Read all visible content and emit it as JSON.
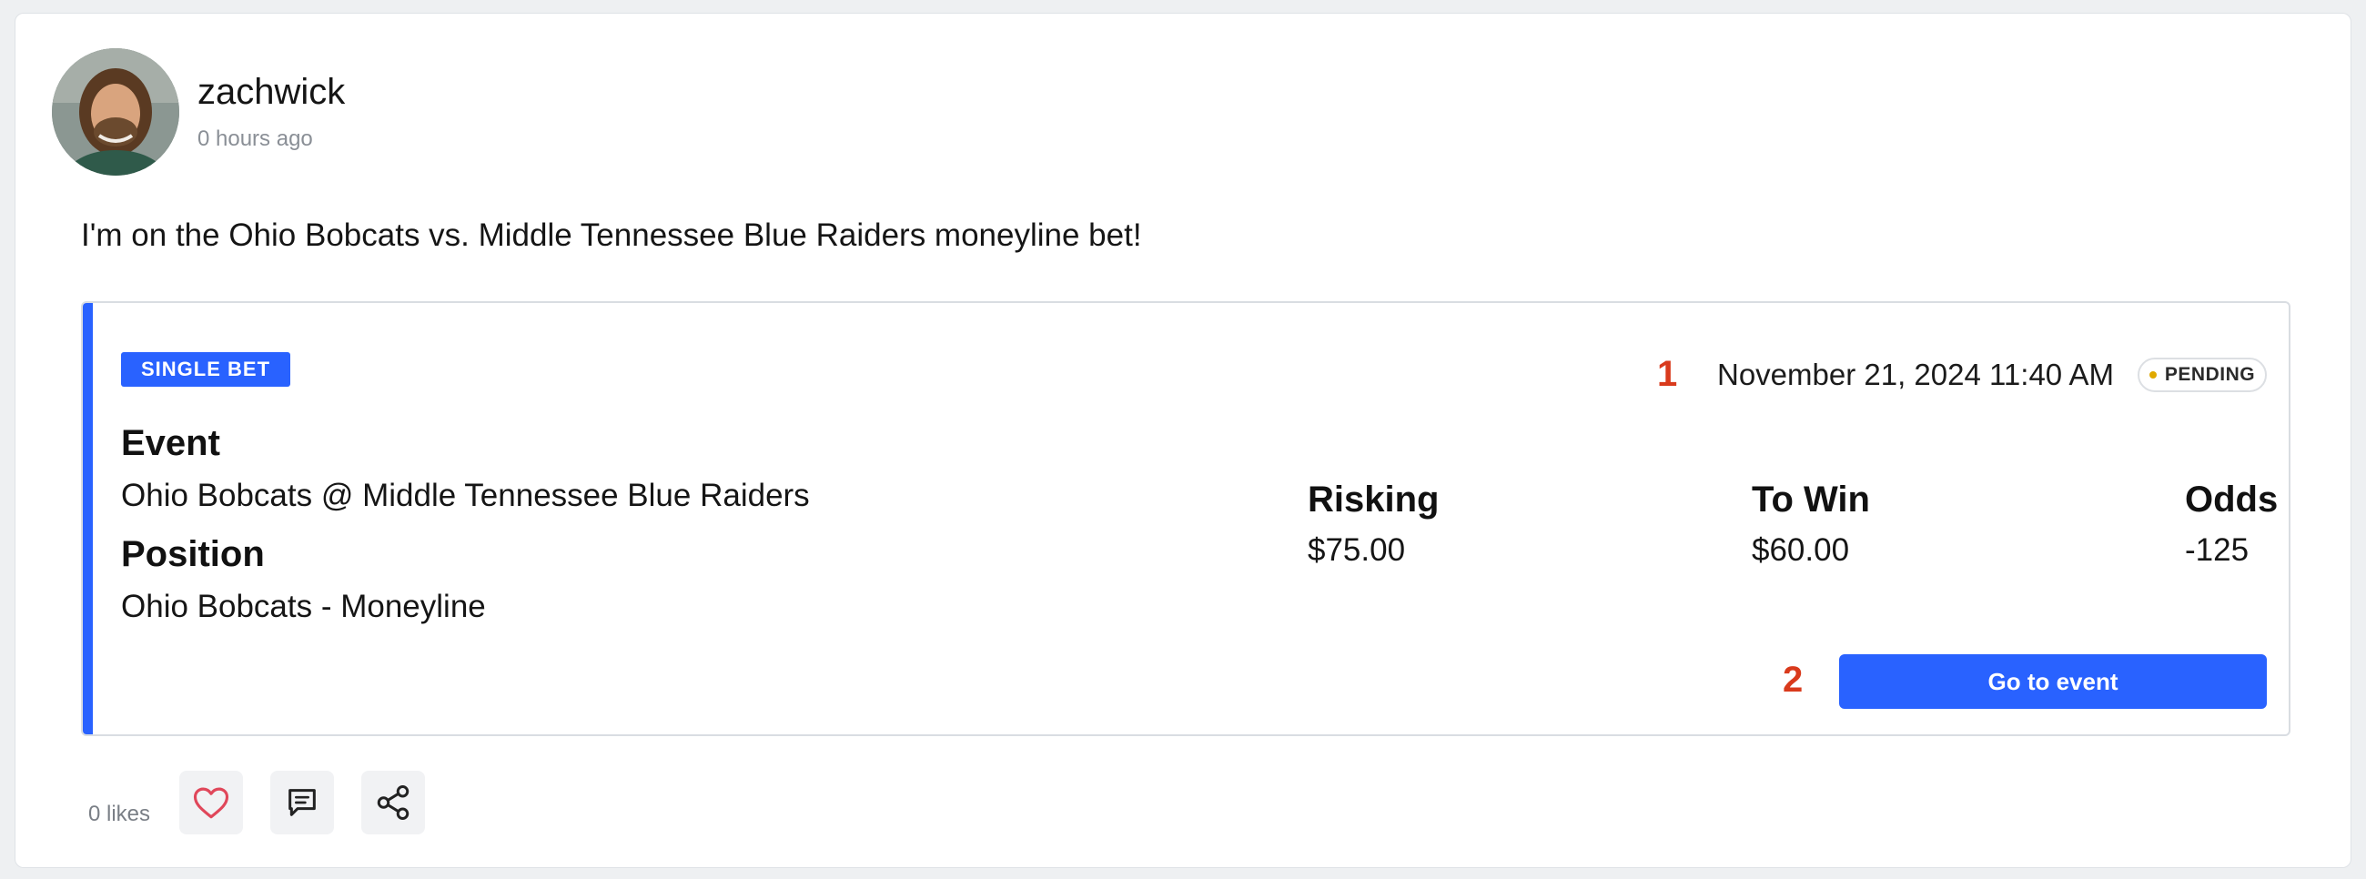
{
  "post": {
    "username": "zachwick",
    "time_ago": "0 hours ago",
    "text": "I'm on the Ohio Bobcats vs. Middle Tennessee Blue Raiders moneyline bet!"
  },
  "bet": {
    "badge": "SINGLE BET",
    "marker_1": "1",
    "marker_2": "2",
    "datetime": "November 21, 2024 11:40 AM",
    "status": "PENDING",
    "event_label": "Event",
    "event_value": "Ohio Bobcats @ Middle Tennessee Blue Raiders",
    "position_label": "Position",
    "position_value": "Ohio Bobcats - Moneyline",
    "risking_label": "Risking",
    "risking_value": "$75.00",
    "towin_label": "To Win",
    "towin_value": "$60.00",
    "odds_label": "Odds",
    "odds_value": "-125",
    "go_button": "Go to event"
  },
  "footer": {
    "likes": "0 likes"
  },
  "colors": {
    "accent": "#2962ff",
    "marker": "#d93a1c",
    "status_dot": "#e0a900",
    "heart": "#e0475a"
  },
  "icons": {
    "like": "heart-icon",
    "comment": "comment-icon",
    "share": "share-icon"
  }
}
